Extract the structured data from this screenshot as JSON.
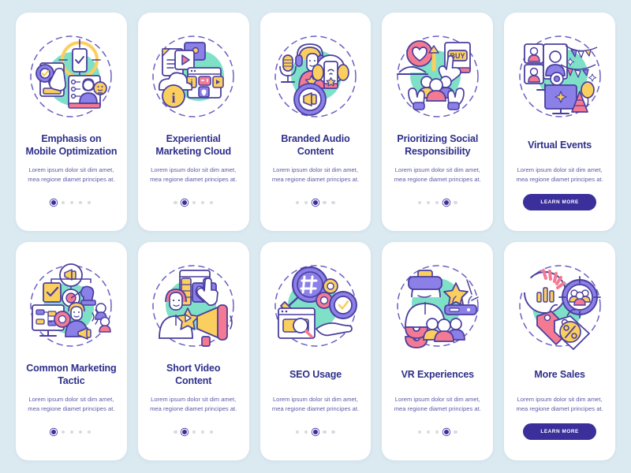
{
  "theme": {
    "page_background": "#dbe9f1",
    "card_background": "#ffffff",
    "title_color": "#2e2f8a",
    "body_color": "#5b5ba8",
    "accent_color": "#3b2f9b",
    "dot_inactive_color": "#d9d9e3",
    "illustration_mint": "#7fe0c8",
    "illustration_purple": "#8b7fe8",
    "illustration_yellow": "#fbcf5e",
    "illustration_pink": "#f47a94",
    "illustration_outline": "#4a3f9e"
  },
  "cards": [
    {
      "id": "emphasis-on-mobile-optimization",
      "title": "Emphasis on Mobile Optimization",
      "description": "Lorem ipsum dolor sit dim amet, mea regione diamet principes at.",
      "illustration": "mobile-optimization-illustration",
      "footer_type": "dots",
      "dots_total": 5,
      "dots_active_index": 0
    },
    {
      "id": "experiential-marketing-cloud",
      "title": "Experiential Marketing Cloud",
      "description": "Lorem ipsum dolor sit dim amet, mea regione diamet principes at.",
      "illustration": "marketing-cloud-illustration",
      "footer_type": "dots",
      "dots_total": 5,
      "dots_active_index": 1
    },
    {
      "id": "branded-audio-content",
      "title": "Branded Audio Content",
      "description": "Lorem ipsum dolor sit dim amet, mea regione diamet principes at.",
      "illustration": "branded-audio-illustration",
      "footer_type": "dots",
      "dots_total": 5,
      "dots_active_index": 2
    },
    {
      "id": "prioritizing-social-responsibility",
      "title": "Prioritizing Social Responsibility",
      "description": "Lorem ipsum dolor sit dim amet, mea regione diamet principes at.",
      "illustration": "social-responsibility-illustration",
      "footer_type": "dots",
      "dots_total": 5,
      "dots_active_index": 3
    },
    {
      "id": "virtual-events",
      "title": "Virtual Events",
      "description": "Lorem ipsum dolor sit dim amet, mea regione diamet principes at.",
      "illustration": "virtual-events-illustration",
      "footer_type": "button",
      "button_label": "LEARN MORE"
    },
    {
      "id": "common-marketing-tactic",
      "title": "Common Marketing Tactic",
      "description": "Lorem ipsum dolor sit dim amet, mea regione diamet principes at.",
      "illustration": "marketing-tactic-illustration",
      "footer_type": "dots",
      "dots_total": 5,
      "dots_active_index": 0
    },
    {
      "id": "short-video-content",
      "title": "Short Video Content",
      "description": "Lorem ipsum dolor sit dim amet, mea regione diamet principes at.",
      "illustration": "short-video-illustration",
      "footer_type": "dots",
      "dots_total": 5,
      "dots_active_index": 1
    },
    {
      "id": "seo-usage",
      "title": "SEO Usage",
      "description": "Lorem ipsum dolor sit dim amet, mea regione diamet principes at.",
      "illustration": "seo-usage-illustration",
      "footer_type": "dots",
      "dots_total": 5,
      "dots_active_index": 2
    },
    {
      "id": "vr-experiences",
      "title": "VR Experiences",
      "description": "Lorem ipsum dolor sit dim amet, mea regione diamet principes at.",
      "illustration": "vr-experiences-illustration",
      "footer_type": "dots",
      "dots_total": 5,
      "dots_active_index": 3
    },
    {
      "id": "more-sales",
      "title": "More Sales",
      "description": "Lorem ipsum dolor sit dim amet, mea regione diamet principes at.",
      "illustration": "more-sales-illustration",
      "footer_type": "button",
      "button_label": "LEARN MORE"
    }
  ]
}
